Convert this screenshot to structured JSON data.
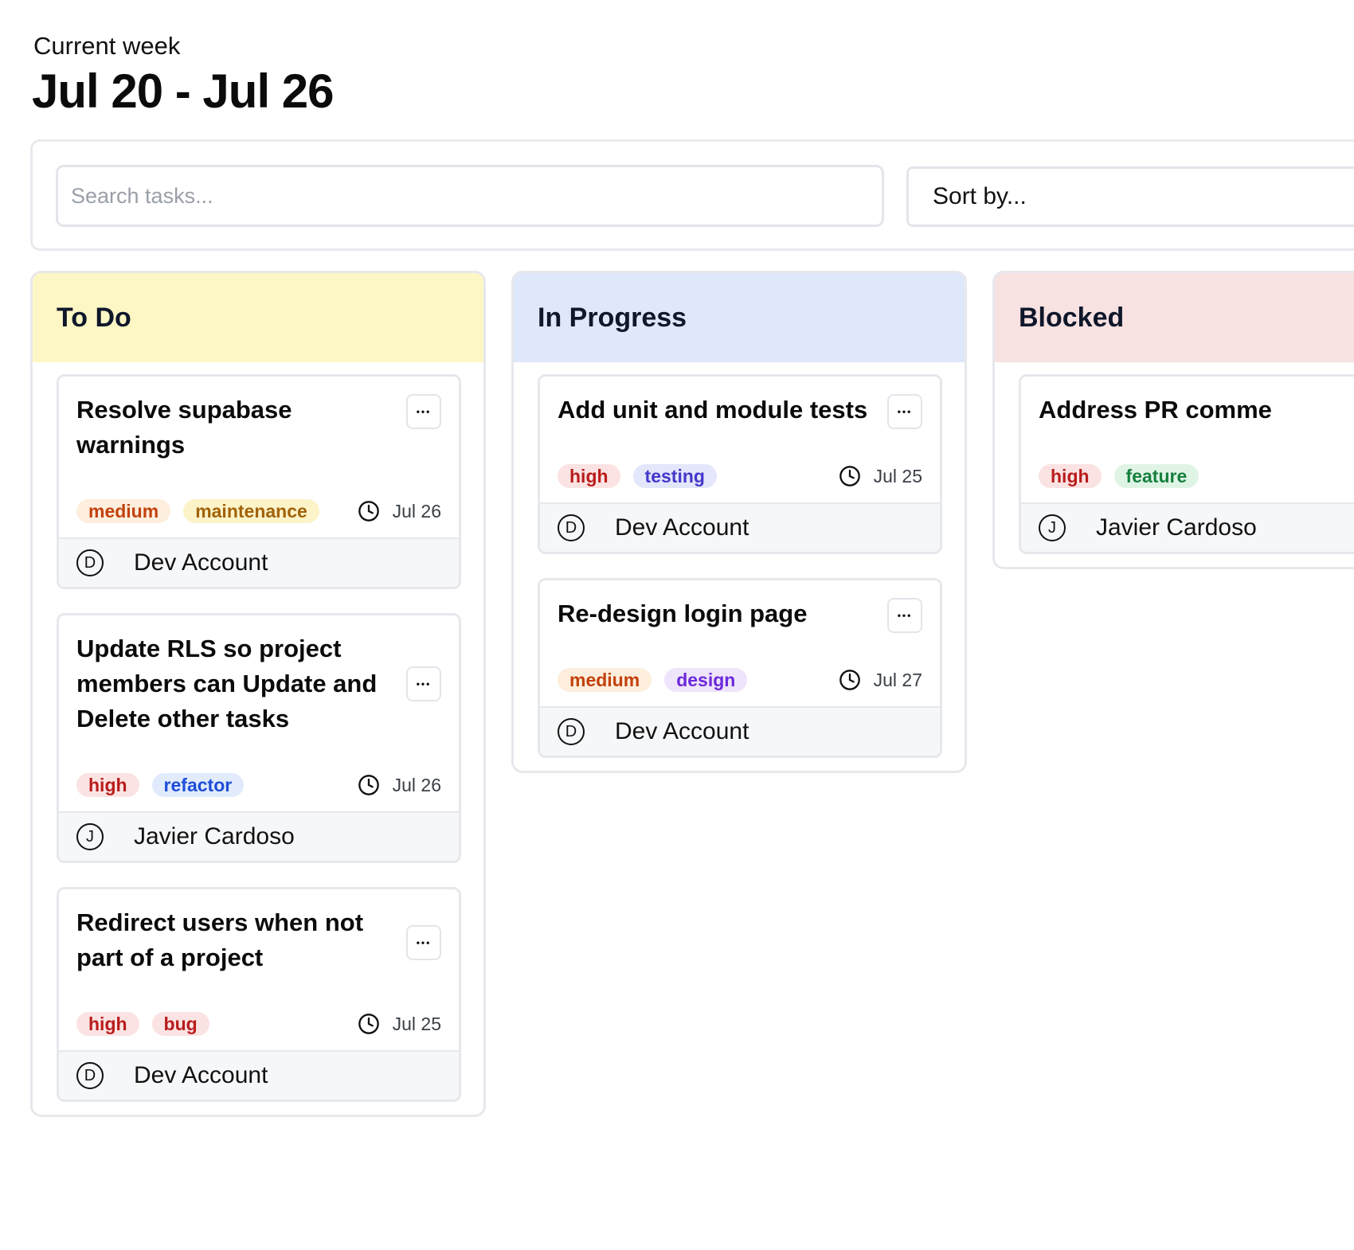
{
  "header": {
    "label": "Current week",
    "range": "Jul 20 - Jul 26"
  },
  "toolbar": {
    "search_placeholder": "Search tasks...",
    "sort_label": "Sort by..."
  },
  "colors": {
    "todo_header": "#fdf7c5",
    "inprogress_header": "#dfe8fa",
    "blocked_header": "#f7e1e1"
  },
  "columns": [
    {
      "title": "To Do",
      "cards": [
        {
          "title": "Resolve supabase warnings",
          "tags": [
            {
              "label": "medium",
              "color": "#c2410c",
              "bg": "#fdeedd"
            },
            {
              "label": "maintenance",
              "color": "#a16207",
              "bg": "#fcf3c8"
            }
          ],
          "due": "Jul 26",
          "assignee_initial": "D",
          "assignee": "Dev Account"
        },
        {
          "title": "Update RLS so project members can Update and Delete other tasks",
          "tags": [
            {
              "label": "high",
              "color": "#b91c1c",
              "bg": "#fbe3e3"
            },
            {
              "label": "refactor",
              "color": "#1d4ed8",
              "bg": "#e1ebfb"
            }
          ],
          "due": "Jul 26",
          "assignee_initial": "J",
          "assignee": "Javier Cardoso"
        },
        {
          "title": "Redirect users when not part of a project",
          "tags": [
            {
              "label": "high",
              "color": "#b91c1c",
              "bg": "#fbe3e3"
            },
            {
              "label": "bug",
              "color": "#b91c1c",
              "bg": "#fbe3e3"
            }
          ],
          "due": "Jul 25",
          "assignee_initial": "D",
          "assignee": "Dev Account"
        }
      ]
    },
    {
      "title": "In Progress",
      "cards": [
        {
          "title": "Add unit and module tests",
          "tags": [
            {
              "label": "high",
              "color": "#b91c1c",
              "bg": "#fbe3e3"
            },
            {
              "label": "testing",
              "color": "#4338ca",
              "bg": "#e4e6fb"
            }
          ],
          "due": "Jul 25",
          "assignee_initial": "D",
          "assignee": "Dev Account"
        },
        {
          "title": "Re-design login page",
          "tags": [
            {
              "label": "medium",
              "color": "#c2410c",
              "bg": "#fdeedd"
            },
            {
              "label": "design",
              "color": "#6d28d9",
              "bg": "#eee5fb"
            }
          ],
          "due": "Jul 27",
          "assignee_initial": "D",
          "assignee": "Dev Account"
        }
      ]
    },
    {
      "title": "Blocked",
      "cards": [
        {
          "title": "Address PR comme",
          "tags": [
            {
              "label": "high",
              "color": "#b91c1c",
              "bg": "#fbe3e3"
            },
            {
              "label": "feature",
              "color": "#15803d",
              "bg": "#e0f4e6"
            }
          ],
          "due": "",
          "assignee_initial": "J",
          "assignee": "Javier Cardoso"
        }
      ]
    }
  ]
}
